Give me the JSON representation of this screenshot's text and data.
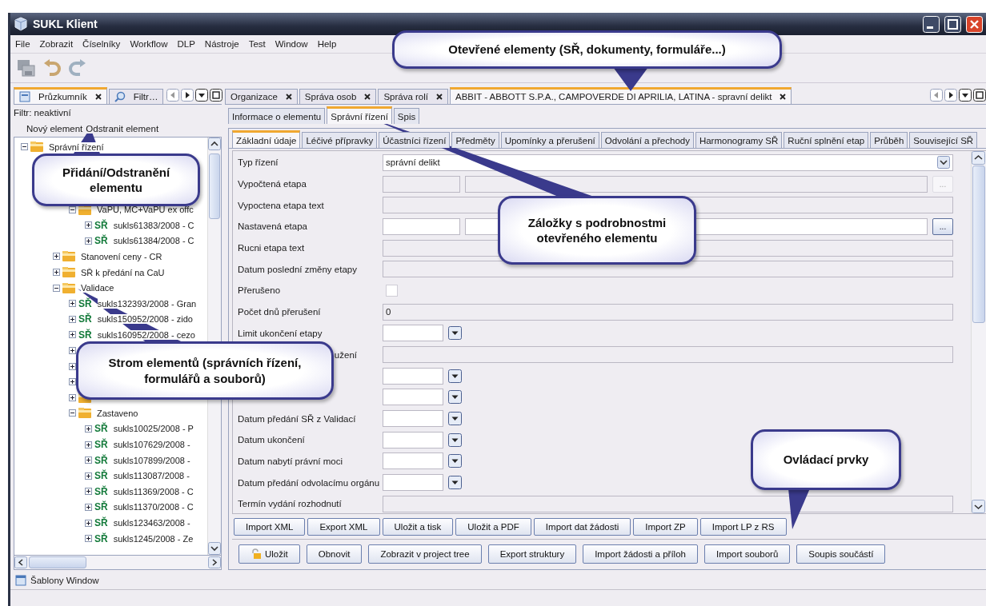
{
  "window": {
    "title": "SUKL Klient"
  },
  "menu": [
    "File",
    "Zobrazit",
    "Číselníky",
    "Workflow",
    "DLP",
    "Nástroje",
    "Test",
    "Window",
    "Help"
  ],
  "toolbar": [
    {
      "kind": "save"
    },
    {
      "kind": "undo"
    },
    {
      "kind": "redo"
    }
  ],
  "explorer": {
    "tabs": [
      {
        "label": "Průzkumník",
        "selected": true,
        "closable": true
      },
      {
        "label": "Filtr…",
        "selected": false,
        "closable": false
      }
    ],
    "filter_status": "Filtr: neaktivní",
    "actions": [
      "Nový element",
      "Odstranit element"
    ],
    "tree": [
      {
        "kind": "folder",
        "label": "Správní řízení",
        "expanded": true,
        "children": [
          {
            "children": [
              {
                "children": [
                  {
                    "kind": "folder",
                    "label": "VaPU, MC+VaPU ex offc",
                    "expanded": true,
                    "children": [
                      {
                        "kind": "record",
                        "badge": "SŘ",
                        "label": "sukls61383/2008 - C",
                        "expanded": false
                      },
                      {
                        "kind": "record",
                        "badge": "SŘ",
                        "label": "sukls61384/2008 - C",
                        "expanded": false
                      }
                    ]
                  }
                ]
              },
              {
                "kind": "folder",
                "label": "Stanovení ceny - CR",
                "expanded": false
              },
              {
                "kind": "folder",
                "label": "SŘ k předání na CaU",
                "expanded": false
              },
              {
                "kind": "folder",
                "label": "Validace",
                "expanded": true,
                "children": [
                  {
                    "kind": "record",
                    "badge": "SŘ",
                    "label": "sukls132393/2008 - Gran",
                    "expanded": false
                  },
                  {
                    "kind": "record",
                    "badge": "SŘ",
                    "label": "sukls150952/2008 - zido",
                    "expanded": false
                  },
                  {
                    "kind": "record",
                    "badge": "SŘ",
                    "label": "sukls160952/2008 - cezo",
                    "expanded": false
                  },
                  {
                    "expanded": false
                  },
                  {
                    "expanded": false
                  },
                  {
                    "expanded": false
                  },
                  {
                    "kind": "folder",
                    "expanded": false
                  },
                  {
                    "kind": "folder",
                    "label": "Zastaveno",
                    "expanded": true,
                    "children": [
                      {
                        "kind": "record",
                        "badge": "SŘ",
                        "label": "sukls10025/2008 - P",
                        "expanded": false
                      },
                      {
                        "kind": "record",
                        "badge": "SŘ",
                        "label": "sukls107629/2008 -",
                        "expanded": false
                      },
                      {
                        "kind": "record",
                        "badge": "SŘ",
                        "label": "sukls107899/2008 -",
                        "expanded": false
                      },
                      {
                        "kind": "record",
                        "badge": "SŘ",
                        "label": "sukls113087/2008 -",
                        "expanded": false
                      },
                      {
                        "kind": "record",
                        "badge": "SŘ",
                        "label": "sukls11369/2008 - C",
                        "expanded": false
                      },
                      {
                        "kind": "record",
                        "badge": "SŘ",
                        "label": "sukls11370/2008 - C",
                        "expanded": false
                      },
                      {
                        "kind": "record",
                        "badge": "SŘ",
                        "label": "sukls123463/2008 -",
                        "expanded": false
                      },
                      {
                        "kind": "record",
                        "badge": "SŘ",
                        "label": "sukls1245/2008 - Ze",
                        "expanded": false
                      }
                    ]
                  }
                ]
              }
            ]
          }
        ]
      }
    ]
  },
  "bottom_panel": {
    "label": "Šablony Window"
  },
  "documents": {
    "tabs": [
      {
        "label": "Organizace",
        "selected": false
      },
      {
        "label": "Správa osob",
        "selected": false
      },
      {
        "label": "Správa rolí",
        "selected": false
      },
      {
        "label": "ABBIT - ABBOTT S.P.A., CAMPOVERDE DI APRILIA, LATINA - spravní delikt",
        "selected": true
      }
    ],
    "subtabs": [
      {
        "label": "Informace o elementu",
        "selected": false
      },
      {
        "label": "Správní řízení",
        "selected": true
      },
      {
        "label": "Spis",
        "selected": false
      }
    ],
    "detail_tabs": [
      {
        "label": "Základní údaje",
        "selected": true
      },
      {
        "label": "Léčivé přípravky",
        "selected": false
      },
      {
        "label": "Účastníci řízení",
        "selected": false
      },
      {
        "label": "Předměty",
        "selected": false
      },
      {
        "label": "Upomínky a přerušení",
        "selected": false
      },
      {
        "label": "Odvolání a přechody",
        "selected": false
      },
      {
        "label": "Harmonogramy SŘ",
        "selected": false
      },
      {
        "label": "Ruční splnění etap",
        "selected": false
      },
      {
        "label": "Průběh",
        "selected": false
      },
      {
        "label": "Související SŘ",
        "selected": false
      }
    ],
    "form": [
      {
        "label": "Typ řízení",
        "kind": "combo",
        "value": "správní delikt",
        "disabled": false
      },
      {
        "label": "Vypočtená etapa",
        "kind": "pair",
        "action": "...",
        "disabled": true
      },
      {
        "label": "Vypoctena etapa text",
        "kind": "text",
        "disabled": true
      },
      {
        "label": "Nastavená etapa",
        "kind": "pair",
        "action": "...",
        "disabled": false
      },
      {
        "label": "Rucni etapa text",
        "kind": "text",
        "disabled": true
      },
      {
        "label": "Datum poslední změny etapy",
        "kind": "text",
        "disabled": true
      },
      {
        "label": "Přerušeno",
        "kind": "checkbox",
        "checked": false
      },
      {
        "label": "Počet dnů přerušení",
        "kind": "text",
        "value": "0",
        "disabled": true
      },
      {
        "label": "Limit ukončení etapy",
        "kind": "date"
      },
      {
        "label": "užení",
        "label_cut": true,
        "kind": "text",
        "disabled": true
      },
      {
        "kind": "date"
      },
      {
        "kind": "date"
      },
      {
        "label": "Datum předání SŘ z Validací",
        "kind": "date"
      },
      {
        "label": "Datum ukončení",
        "kind": "date"
      },
      {
        "label": "Datum nabytí právní moci",
        "kind": "date"
      },
      {
        "label": "Datum předání odvolacímu orgánu",
        "kind": "date"
      },
      {
        "label": "Termín vydání rozhodnutí",
        "kind": "text",
        "disabled": true
      }
    ],
    "action_buttons": [
      "Import XML",
      "Export XML",
      "Uložit a tisk",
      "Uložit a PDF",
      "Import dat žádosti",
      "Import ZP",
      "Import LP z RS"
    ],
    "main_buttons": [
      {
        "label": "Uložit",
        "kind": "lock"
      },
      {
        "label": "Obnovit",
        "kind": "plain"
      },
      {
        "label": "Zobrazit v project tree",
        "kind": "plain"
      },
      {
        "label": "Export struktury",
        "kind": "plain"
      },
      {
        "label": "Import žádosti a příloh",
        "kind": "plain"
      },
      {
        "label": "Import souborů",
        "kind": "plain"
      },
      {
        "label": "Soupis součástí",
        "kind": "plain"
      }
    ]
  },
  "callouts": [
    "Otevřené elementy (SŘ, dokumenty, formuláře...)",
    "Přidání/Odstranění elementu",
    "Záložky s podrobnostmi otevřeného elementu",
    "Strom elementů (správních řízení, formulářů a souborů)",
    "Ovládací prvky"
  ]
}
